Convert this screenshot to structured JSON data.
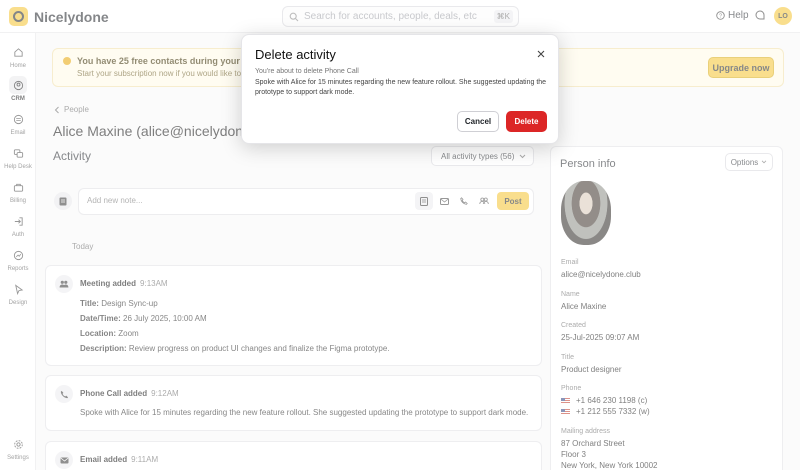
{
  "app": {
    "brand": "Nicelydone",
    "search_placeholder": "Search for accounts, people, deals, etc",
    "search_shortcut": "⌘K",
    "help_label": "Help",
    "avatar_initials": "LO"
  },
  "sidebar": {
    "items": [
      {
        "label": "Home",
        "icon": "home-icon"
      },
      {
        "label": "CRM",
        "icon": "crm-icon",
        "active": true
      },
      {
        "label": "Email",
        "icon": "email-icon"
      },
      {
        "label": "Help Desk",
        "icon": "helpdesk-icon"
      },
      {
        "label": "Billing",
        "icon": "billing-icon"
      },
      {
        "label": "Auth",
        "icon": "auth-icon"
      },
      {
        "label": "Reports",
        "icon": "reports-icon"
      },
      {
        "label": "Design",
        "icon": "design-icon"
      }
    ],
    "settings_label": "Settings"
  },
  "trial": {
    "title": "You have 25 free contacts during your free trial",
    "subtitle": "Start your subscription now if you would like to a",
    "upgrade_label": "Upgrade now"
  },
  "page": {
    "breadcrumb": "People",
    "person_title": "Alice Maxine (alice@nicelydone.club)",
    "activity_title": "Activity",
    "filter_label": "All activity types (56)",
    "note_placeholder": "Add new note...",
    "post_label": "Post",
    "today_label": "Today"
  },
  "activities": [
    {
      "type": "Meeting added",
      "time": "9:13AM",
      "fields": [
        {
          "label": "Title:",
          "value": "Design Sync-up"
        },
        {
          "label": "Date/Time:",
          "value": "26 July 2025, 10:00 AM"
        },
        {
          "label": "Location:",
          "value": "Zoom"
        },
        {
          "label": "Description:",
          "value": "Review progress on product UI changes and finalize the Figma prototype."
        }
      ]
    },
    {
      "type": "Phone Call added",
      "time": "9:12AM",
      "body": "Spoke with Alice for 15 minutes regarding the new feature rollout. She suggested updating the prototype to support dark mode."
    },
    {
      "type": "Email added",
      "time": "9:11AM"
    }
  ],
  "person_info": {
    "title": "Person info",
    "options_label": "Options",
    "email_label": "Email",
    "email": "alice@nicelydone.club",
    "name_label": "Name",
    "name": "Alice Maxine",
    "created_label": "Created",
    "created": "25-Jul-2025 09:07 AM",
    "title_label": "Title",
    "job_title": "Product designer",
    "phone_label": "Phone",
    "phones": [
      "+1 646 230 1198 (c)",
      "+1 212 555 7332 (w)"
    ],
    "address_label": "Mailing address",
    "address_lines": [
      "87 Orchard Street",
      "Floor 3",
      "New York, New York  10002"
    ]
  },
  "modal": {
    "title": "Delete activity",
    "subtitle": "You're about to delete Phone Call",
    "body": "Spoke with Alice for 15 minutes regarding the new feature rollout. She suggested updating the prototype to support dark mode.",
    "cancel_label": "Cancel",
    "delete_label": "Delete"
  }
}
